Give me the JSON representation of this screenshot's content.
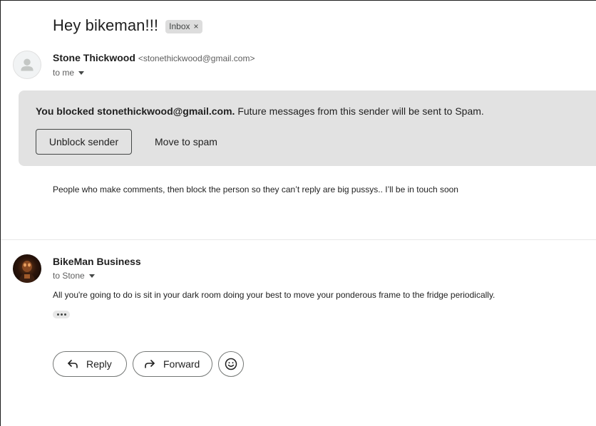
{
  "thread": {
    "subject": "Hey bikeman!!!",
    "label": "Inbox",
    "label_close": "×"
  },
  "messages": [
    {
      "sender_name": "Stone Thickwood",
      "sender_email": "<stonethickwood@gmail.com>",
      "recipient": "to me",
      "avatar": "default-person-icon",
      "body": "People who make comments, then block the person so they can’t reply are big pussys..  I’ll be in touch soon"
    },
    {
      "sender_name": "BikeMan Business",
      "recipient": "to Stone",
      "avatar": "photo",
      "body": "All you're going to do is sit in your dark room doing your best to move your ponderous frame to the fridge periodically."
    }
  ],
  "blocked_banner": {
    "bold_text": "You blocked stonethickwood@gmail.com.",
    "rest_text": " Future messages from this sender will be sent to Spam.",
    "unblock_label": "Unblock sender",
    "spam_label": "Move to spam"
  },
  "actions": {
    "reply_label": "Reply",
    "forward_label": "Forward",
    "reply_icon": "reply-arrow-icon",
    "forward_icon": "forward-arrow-icon",
    "emoji_icon": "smiley-icon"
  },
  "colors": {
    "banner_bg": "#e2e2e2",
    "chip_bg": "#dddddd",
    "text": "#1f1f1f",
    "muted": "#5e5e5e"
  }
}
